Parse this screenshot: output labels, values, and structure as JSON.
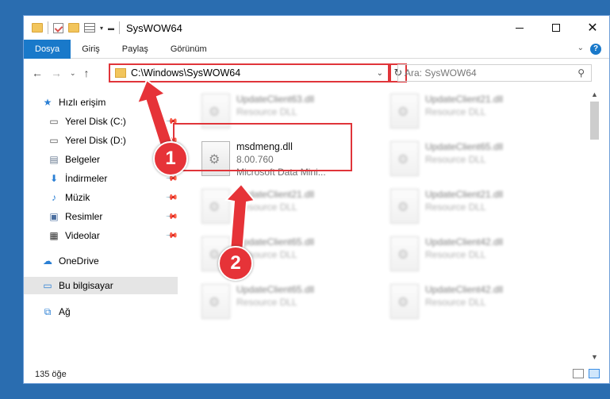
{
  "window": {
    "title": "SysWOW64",
    "min": "—",
    "max": "☐",
    "close": "✕"
  },
  "ribbon": {
    "tabs": [
      "Dosya",
      "Giriş",
      "Paylaş",
      "Görünüm"
    ],
    "help": "?"
  },
  "address": {
    "path": "C:\\Windows\\SysWOW64",
    "search_placeholder": "Ara: SysWOW64"
  },
  "nav_pane": {
    "items": [
      {
        "label": "Hızlı erişim",
        "icon": "star-icon"
      },
      {
        "label": "Yerel Disk (C:)",
        "icon": "drive-icon"
      },
      {
        "label": "Yerel Disk (D:)",
        "icon": "drive-icon"
      },
      {
        "label": "Belgeler",
        "icon": "documents-icon"
      },
      {
        "label": "İndirmeler",
        "icon": "download-icon"
      },
      {
        "label": "Müzik",
        "icon": "music-icon"
      },
      {
        "label": "Resimler",
        "icon": "pictures-icon"
      },
      {
        "label": "Videolar",
        "icon": "video-icon"
      },
      {
        "label": "OneDrive",
        "icon": "cloud-icon"
      },
      {
        "label": "Bu bilgisayar",
        "icon": "computer-icon"
      },
      {
        "label": "Ağ",
        "icon": "network-icon"
      }
    ]
  },
  "files": [
    {
      "name": "UpdateClient63.dll",
      "sub": "Resource DLL"
    },
    {
      "name": "UpdateClient21.dll",
      "sub": "Resource DLL"
    },
    {
      "name": "msdmeng.dll",
      "sub": "8.00.760",
      "sub2": "Microsoft Data Mini..."
    },
    {
      "name": "UpdateClient65.dll",
      "sub": "Resource DLL"
    },
    {
      "name": "UpdateClient21.dll",
      "sub": "Resource DLL"
    },
    {
      "name": "UpdateClient21.dll",
      "sub": "Resource DLL"
    },
    {
      "name": "UpdateClient65.dll",
      "sub": "Resource DLL"
    },
    {
      "name": "UpdateClient42.dll",
      "sub": "Resource DLL"
    },
    {
      "name": "UpdateClient65.dll",
      "sub": "Resource DLL"
    },
    {
      "name": "UpdateClient42.dll",
      "sub": "Resource DLL"
    }
  ],
  "status": {
    "count": "135 öğe"
  },
  "callouts": [
    "1",
    "2"
  ],
  "colors": {
    "accent": "#1979ca",
    "highlight": "#e0353a",
    "callout": "#e63338"
  }
}
